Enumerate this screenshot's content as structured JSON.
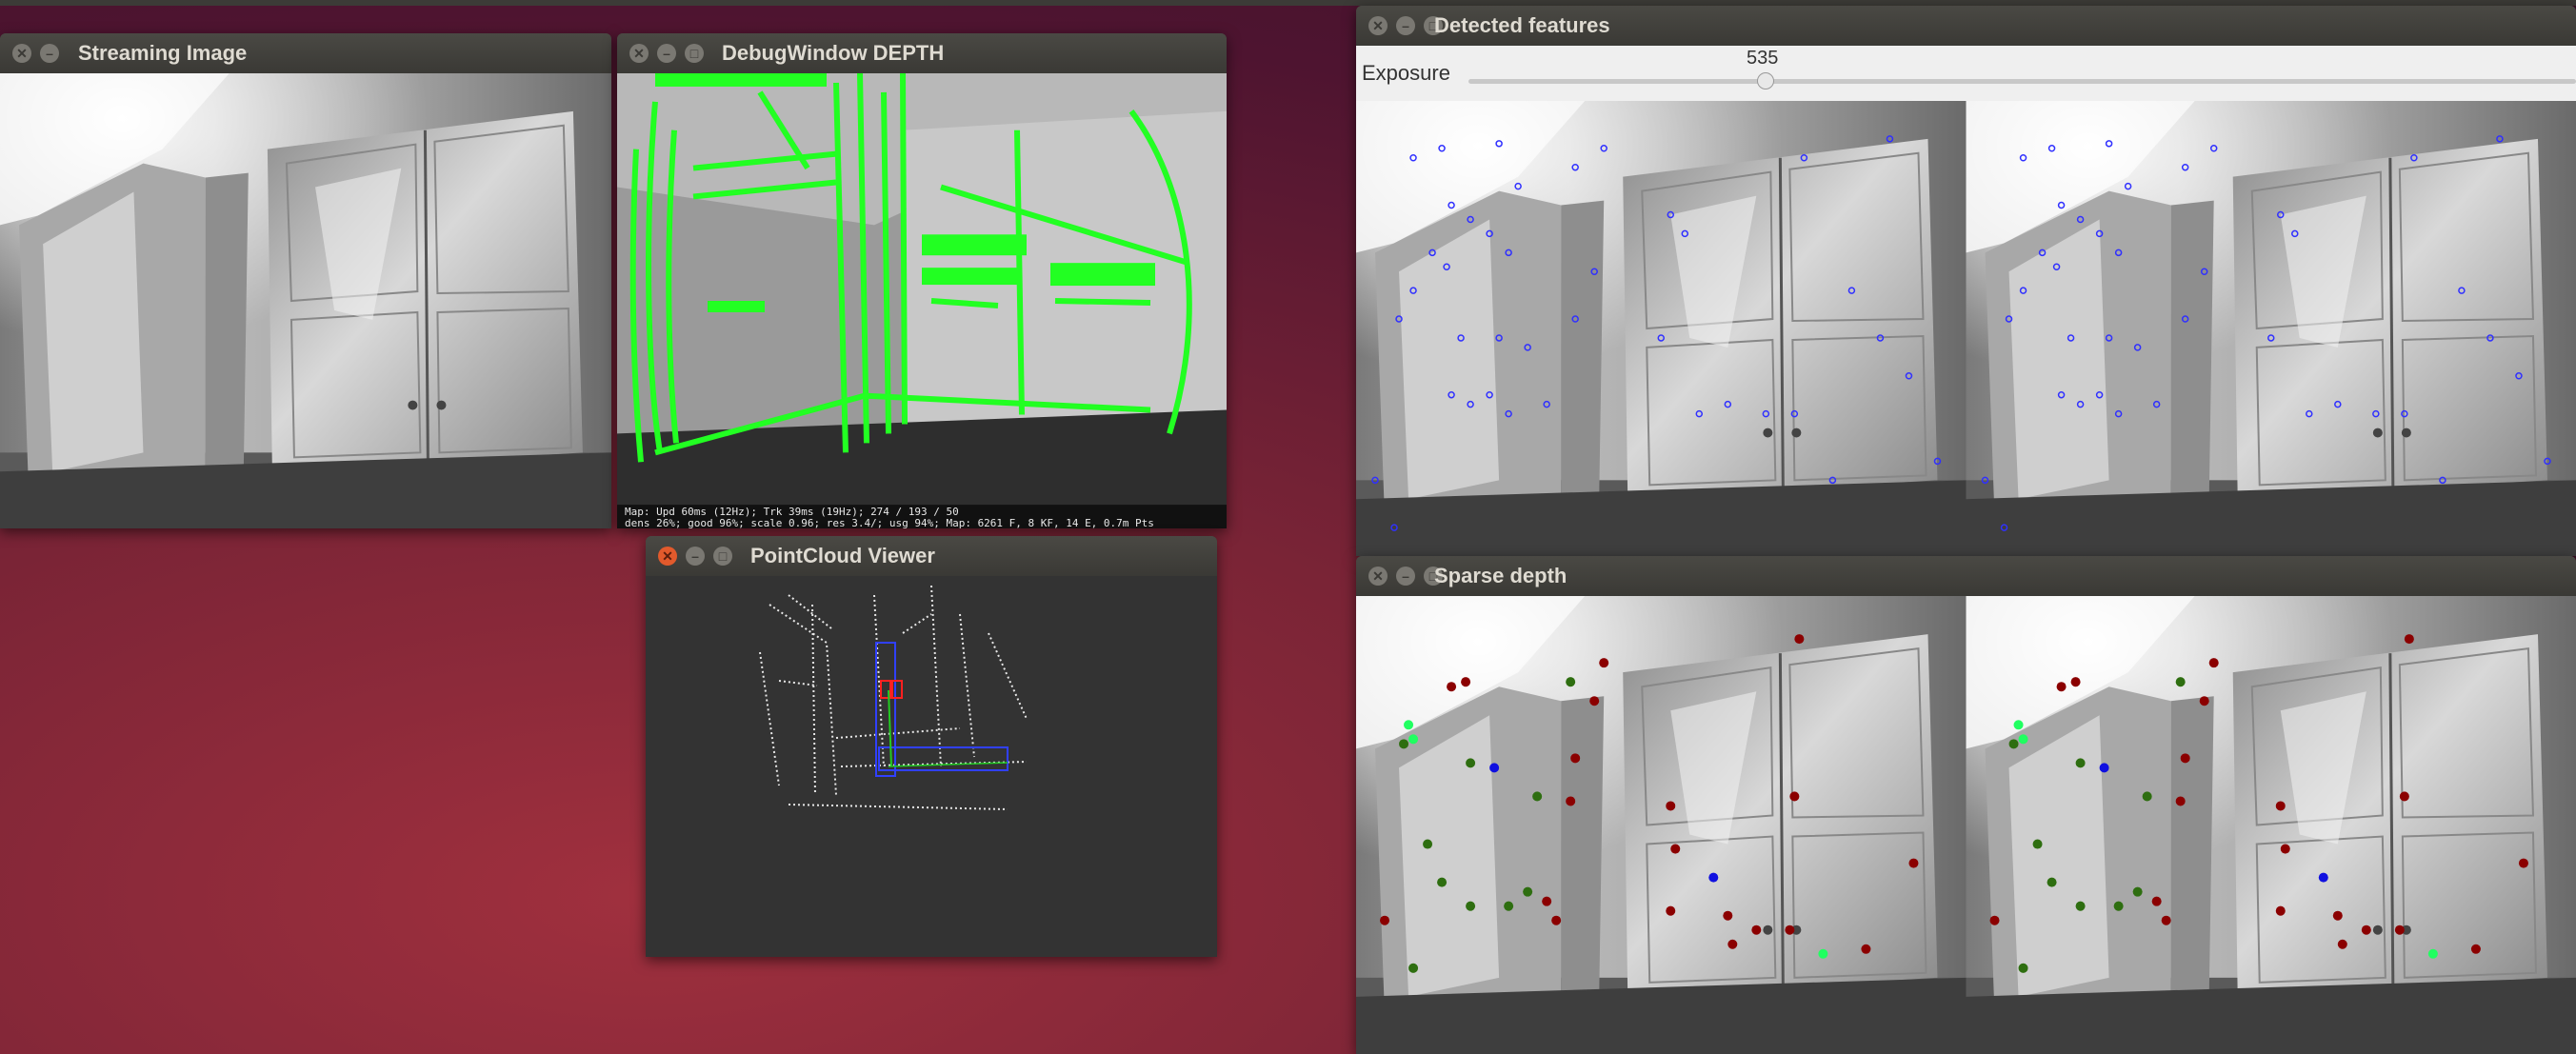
{
  "windows": {
    "streaming": {
      "title": "Streaming Image"
    },
    "debug": {
      "title": "DebugWindow DEPTH",
      "status_line_1": "Map: Upd   60ms (12Hz); Trk   39ms (19Hz); 274 / 193 / 50",
      "status_line_2": "dens 26%; good 96%; scale 0.96; res 3.4/; usg 94%; Map: 6261 F, 8 KF, 14 E, 0.7m Pts"
    },
    "pointcloud": {
      "title": "PointCloud Viewer"
    },
    "features": {
      "title": "Detected features",
      "slider_label": "Exposure",
      "slider_value": "535",
      "slider_fraction": 0.245
    },
    "sparse": {
      "title": "Sparse depth"
    }
  },
  "colors": {
    "feature_marker": "#3030ff",
    "depth_edge": "#22ff22",
    "near_point": "#8b0000",
    "mid_point": "#2e6e10",
    "far_point": "#1010e0",
    "bright_point": "#20ff60"
  },
  "icons": [
    "close-icon",
    "minimize-icon",
    "maximize-icon"
  ]
}
